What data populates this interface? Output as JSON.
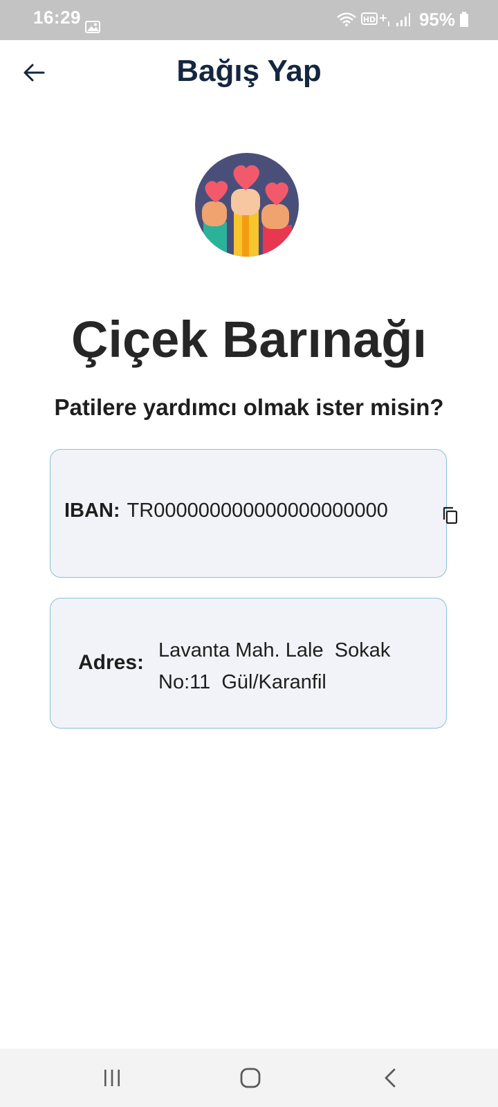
{
  "status_bar": {
    "time": "16:29",
    "battery": "95%",
    "icons": [
      "image-icon",
      "wifi-icon",
      "hd-voice-icon",
      "signal-icon",
      "battery-icon"
    ]
  },
  "app_bar": {
    "title": "Bağış Yap",
    "back_icon": "arrow-left-icon"
  },
  "logo": {
    "icon": "hands-with-hearts-icon",
    "colors": {
      "background": "#4a4f7a",
      "heart": "#f25a6b",
      "sleeve_teal": "#2bb39a",
      "sleeve_yellow": "#f7c52d",
      "sleeve_red": "#e8384f"
    }
  },
  "shelter": {
    "name": "Çiçek Barınağı",
    "subtitle": "Patilere yardımcı olmak ister misin?"
  },
  "iban_card": {
    "label": "IBAN:",
    "value": "TR000000000000000000000",
    "copy_icon": "copy-icon"
  },
  "address_card": {
    "label": "Adres:",
    "line1": "Lavanta Mah. Lale  Sokak",
    "line2": "No:11  Gül/Karanfil"
  },
  "nav_bar": {
    "icons": [
      "recents-icon",
      "home-icon",
      "back-icon"
    ]
  },
  "colors": {
    "title": "#142640",
    "card_background": "#f2f3f8",
    "card_border": "#86c3da",
    "status_bar": "#c3c3c3"
  }
}
